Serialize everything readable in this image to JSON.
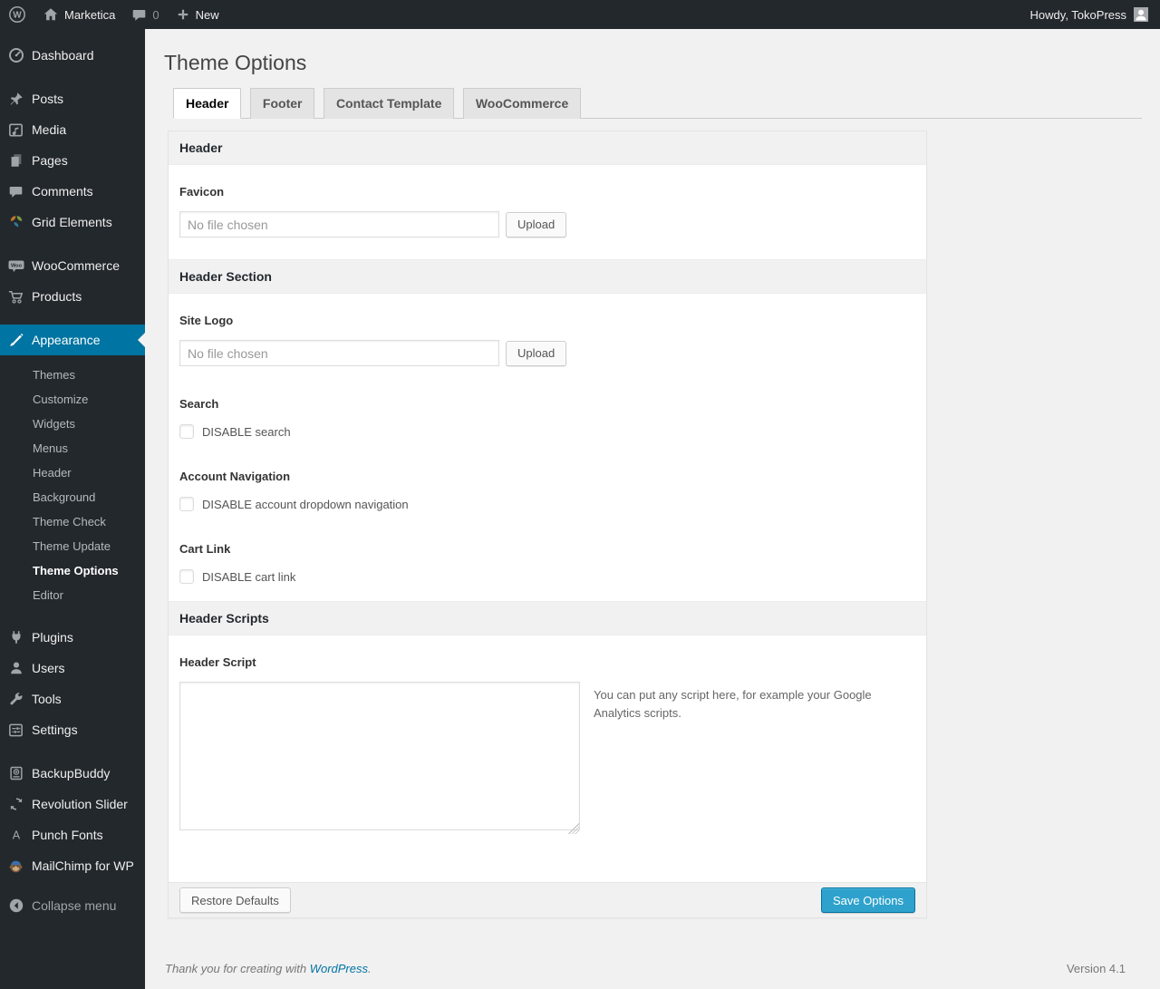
{
  "colors": {
    "sidebar_bg": "#23282d",
    "page_bg": "#f1f1f1",
    "accent": "#0074a2",
    "primary_button": "#2ea2cc",
    "link": "#0074a2"
  },
  "admin_bar": {
    "site_name": "Marketica",
    "comment_count": "0",
    "new_label": "New",
    "howdy": "Howdy, TokoPress",
    "icons": [
      "wordpress-logo-icon",
      "home-icon",
      "comment-bubble-icon",
      "plus-icon",
      "avatar"
    ]
  },
  "sidebar": {
    "items": [
      {
        "label": "Dashboard",
        "icon": "dashboard-icon"
      },
      {
        "label": "Posts",
        "icon": "pin-icon"
      },
      {
        "label": "Media",
        "icon": "media-icon"
      },
      {
        "label": "Pages",
        "icon": "pages-icon"
      },
      {
        "label": "Comments",
        "icon": "comments-icon"
      },
      {
        "label": "Grid Elements",
        "icon": "grid-elements-icon"
      },
      {
        "label": "WooCommerce",
        "icon": "woocommerce-icon"
      },
      {
        "label": "Products",
        "icon": "cart-icon"
      },
      {
        "label": "Appearance",
        "icon": "appearance-icon",
        "active": true
      },
      {
        "label": "Plugins",
        "icon": "plugin-icon"
      },
      {
        "label": "Users",
        "icon": "users-icon"
      },
      {
        "label": "Tools",
        "icon": "tools-icon"
      },
      {
        "label": "Settings",
        "icon": "settings-icon"
      },
      {
        "label": "BackupBuddy",
        "icon": "backupbuddy-icon"
      },
      {
        "label": "Revolution Slider",
        "icon": "revolution-slider-icon"
      },
      {
        "label": "Punch Fonts",
        "icon": "punch-fonts-icon"
      },
      {
        "label": "MailChimp for WP",
        "icon": "mailchimp-icon"
      },
      {
        "label": "Collapse menu",
        "icon": "collapse-icon"
      }
    ],
    "appearance_submenu": [
      "Themes",
      "Customize",
      "Widgets",
      "Menus",
      "Header",
      "Background",
      "Theme Check",
      "Theme Update",
      "Theme Options",
      "Editor"
    ],
    "current_submenu_item": "Theme Options"
  },
  "page": {
    "title": "Theme Options",
    "tabs": [
      {
        "label": "Header",
        "active": true
      },
      {
        "label": "Footer",
        "active": false
      },
      {
        "label": "Contact Template",
        "active": false
      },
      {
        "label": "WooCommerce",
        "active": false
      }
    ],
    "sections": {
      "header": {
        "title": "Header",
        "favicon": {
          "label": "Favicon",
          "file_text": "No file chosen",
          "button": "Upload"
        }
      },
      "header_section": {
        "title": "Header Section",
        "site_logo": {
          "label": "Site Logo",
          "file_text": "No file chosen",
          "button": "Upload"
        },
        "search": {
          "label": "Search",
          "checkbox_label": "DISABLE search",
          "checked": false
        },
        "account_navigation": {
          "label": "Account Navigation",
          "checkbox_label": "DISABLE account dropdown navigation",
          "checked": false
        },
        "cart_link": {
          "label": "Cart Link",
          "checkbox_label": "DISABLE cart link",
          "checked": false
        }
      },
      "header_scripts": {
        "title": "Header Scripts",
        "header_script": {
          "label": "Header Script",
          "value": "",
          "help": "You can put any script here, for example your Google Analytics scripts."
        }
      }
    },
    "actions": {
      "restore": "Restore Defaults",
      "save": "Save Options"
    }
  },
  "footer": {
    "thanks_prefix": "Thank you for creating with ",
    "link": "WordPress",
    "suffix": ".",
    "version": "Version 4.1"
  }
}
